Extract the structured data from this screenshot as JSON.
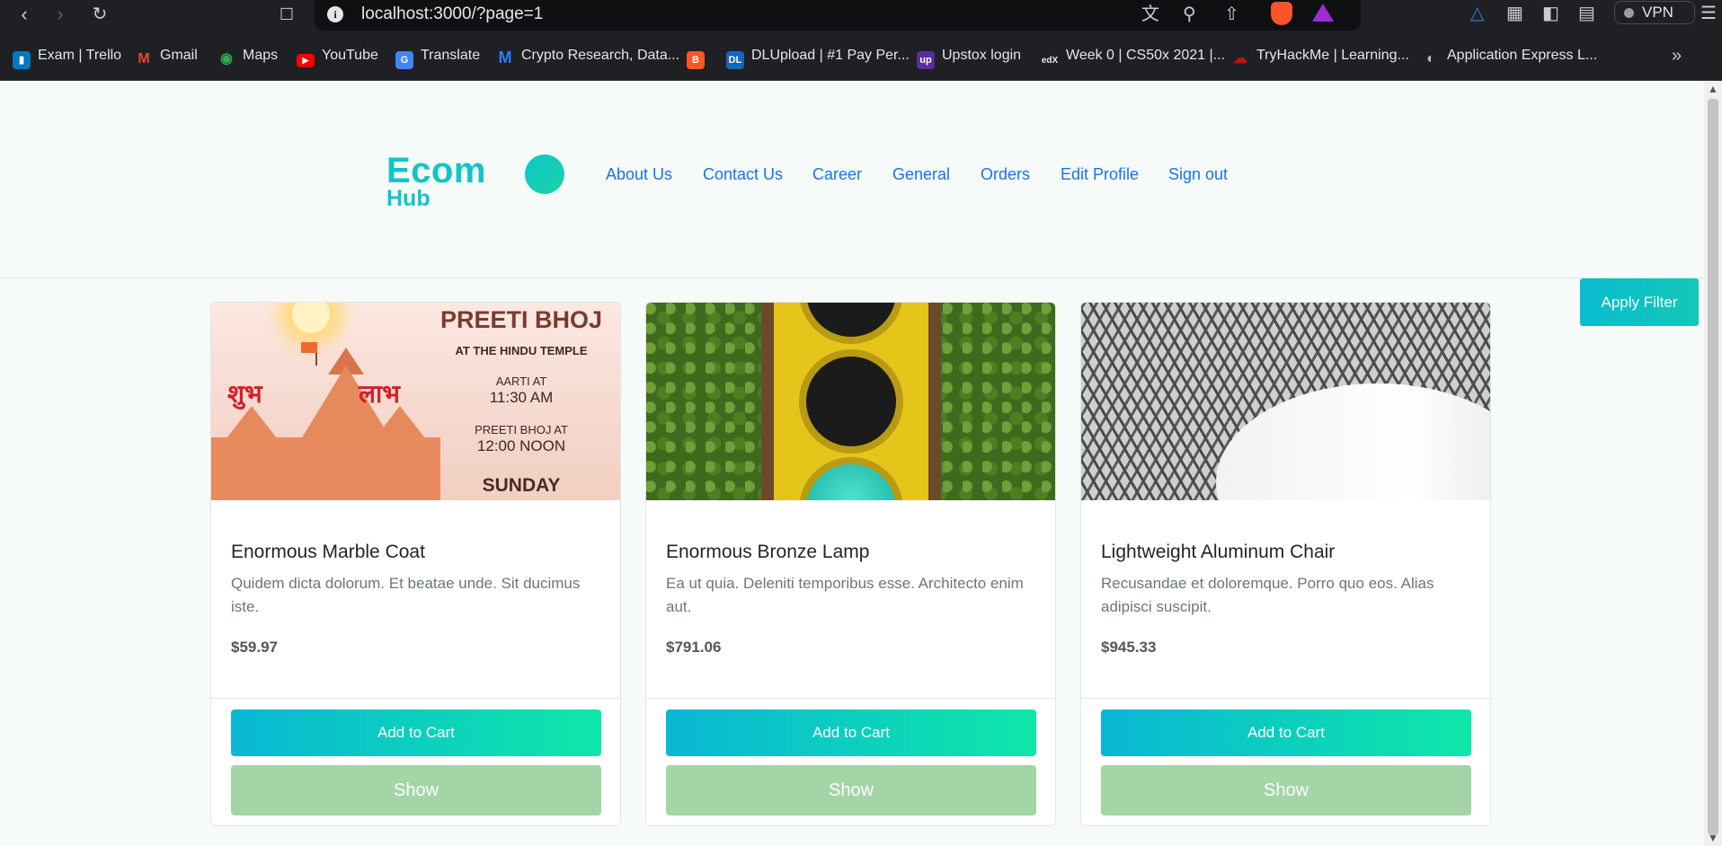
{
  "browser": {
    "url": "localhost:3000/?page=1",
    "vpn_label": "VPN",
    "bookmarks": [
      {
        "label": "Exam | Trello",
        "icon": "trello-icon",
        "color": "#0079bf"
      },
      {
        "label": "Gmail",
        "icon": "gmail-icon",
        "color": "#ea4335"
      },
      {
        "label": "Maps",
        "icon": "maps-icon",
        "color": "#34a853"
      },
      {
        "label": "YouTube",
        "icon": "youtube-icon",
        "color": "#ff0000"
      },
      {
        "label": "Translate",
        "icon": "translate-icon",
        "color": "#4285f4"
      },
      {
        "label": "Crypto Research, Data...",
        "icon": "messari-icon",
        "color": "#2a7fff"
      },
      {
        "label": "",
        "icon": "blogger-icon",
        "color": "#ff5722"
      },
      {
        "label": "DLUpload | #1 Pay Per...",
        "icon": "dlupload-icon",
        "color": "#1565c0"
      },
      {
        "label": "Upstox login",
        "icon": "upstox-icon",
        "color": "#5a2ca0"
      },
      {
        "label": "Week 0 | CS50x 2021 |...",
        "icon": "edx-icon",
        "color": "#1f2023"
      },
      {
        "label": "TryHackMe | Learning...",
        "icon": "tryhackme-icon",
        "color": "#c11111"
      },
      {
        "label": "Application Express L...",
        "icon": "globe-icon",
        "color": "#6b6b6b"
      }
    ]
  },
  "header": {
    "logo_line1": "Ecom",
    "logo_line2": "Hub",
    "nav": [
      "About Us",
      "Contact Us",
      "Career",
      "General",
      "Orders",
      "Edit Profile",
      "Sign out"
    ]
  },
  "filter": {
    "label": "Apply Filter"
  },
  "products": [
    {
      "title": "Enormous Marble Coat",
      "description": "Quidem dicta dolorum. Et beatae unde. Sit ducimus iste.",
      "price": "$59.97",
      "cart_label": "Add to Cart",
      "show_label": "Show",
      "image": {
        "title": "PREETI BHOJ",
        "line1": "AT THE HINDU TEMPLE",
        "line2": "AARTI AT",
        "line3": "11:30 AM",
        "line4": "PREETI BHOJ AT",
        "line5": "12:00 NOON",
        "line6": "SUNDAY",
        "left_word": "शुभ",
        "right_word": "लाभ"
      }
    },
    {
      "title": "Enormous Bronze Lamp",
      "description": "Ea ut quia. Deleniti temporibus esse. Architecto enim aut.",
      "price": "$791.06",
      "cart_label": "Add to Cart",
      "show_label": "Show"
    },
    {
      "title": "Lightweight Aluminum Chair",
      "description": "Recusandae et doloremque. Porro quo eos. Alias adipisci suscipit.",
      "price": "$945.33",
      "cart_label": "Add to Cart",
      "show_label": "Show"
    }
  ],
  "colors": {
    "brand": "#13c4c6",
    "nav_link": "#1a73e8",
    "show_button": "#a3d5a6"
  }
}
